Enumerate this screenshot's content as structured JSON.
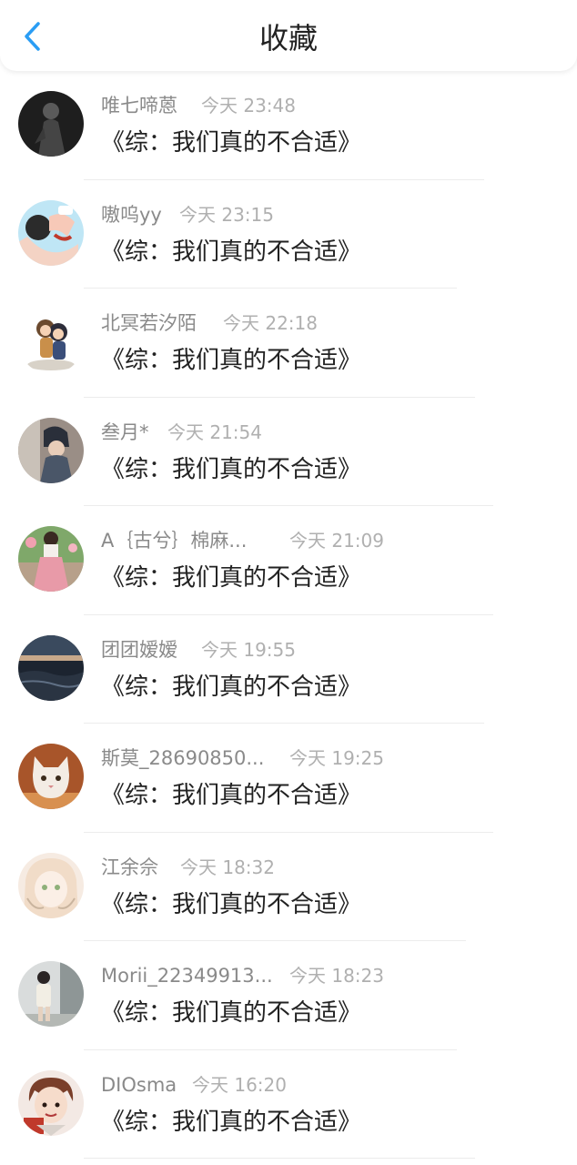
{
  "header": {
    "title": "收藏",
    "back_icon": "chevron-left-icon",
    "accent": "#2a9df4"
  },
  "items": [
    {
      "name": "唯七啼蒽",
      "time": "今天 23:48",
      "message": "《综：我们真的不合适》",
      "avatar": "dark-figure-avatar"
    },
    {
      "name": "嗷呜yy",
      "time": "今天 23:15",
      "message": "《综：我们真的不合适》",
      "avatar": "anime-hands-avatar"
    },
    {
      "name": "北冥若汐陌",
      "time": "今天 22:18",
      "message": "《综：我们真的不合适》",
      "avatar": "chibi-couple-avatar"
    },
    {
      "name": "叁月*",
      "time": "今天 21:54",
      "message": "《综：我们真的不合适》",
      "avatar": "hat-girl-avatar"
    },
    {
      "name": "A｛古兮｝棉麻...",
      "time": "今天 21:09",
      "message": "《综：我们真的不合适》",
      "avatar": "pink-skirt-avatar"
    },
    {
      "name": "团团嫒嫒",
      "time": "今天 19:55",
      "message": "《综：我们真的不合适》",
      "avatar": "sea-sunset-avatar"
    },
    {
      "name": "斯莫_28690850...",
      "time": "今天 19:25",
      "message": "《综：我们真的不合适》",
      "avatar": "cat-avatar"
    },
    {
      "name": "江余佘",
      "time": "今天 18:32",
      "message": "《综：我们真的不合适》",
      "avatar": "anime-girl-avatar"
    },
    {
      "name": "Morii_22349913...",
      "time": "今天 18:23",
      "message": "《综：我们真的不合适》",
      "avatar": "street-girl-avatar"
    },
    {
      "name": "DIOsma",
      "time": "今天 16:20",
      "message": "《综：我们真的不合适》",
      "avatar": "manga-boy-avatar"
    }
  ]
}
